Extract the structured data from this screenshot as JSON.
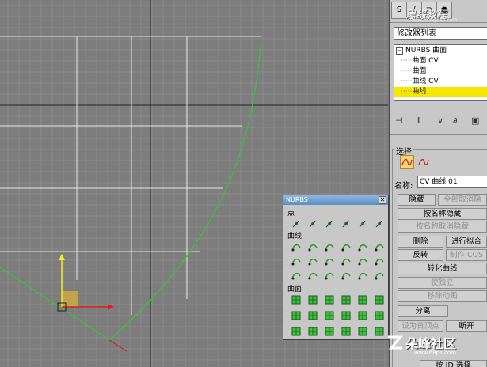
{
  "panel": {
    "tabs": [
      "S",
      "∕",
      "⊃",
      "●"
    ],
    "top_watermark": "思缘教程",
    "top_watermark_sub": "www.missyuan.com",
    "modifier_list_label": "修改器列表",
    "stack": {
      "root": "NURBS 曲面",
      "items": [
        "曲面 CV",
        "曲面",
        "曲线 CV",
        "曲线"
      ],
      "selected_index": 3
    },
    "selection": {
      "title": "选择",
      "name_label": "名称:",
      "name_value": "CV 曲线 01"
    },
    "buttons": {
      "hide": "隐藏",
      "unhide_all": "全部取消隐",
      "hide_by_name": "按名称隐藏",
      "unhide_by_name": "按名称取消隐藏",
      "delete": "删除",
      "attach": "进行拟合",
      "reverse": "反转",
      "make_cos": "制作 COS",
      "convert_curve": "转化曲线",
      "make_independent": "使独立",
      "remove_animation": "移除动画",
      "detach": "分离",
      "copy": "复制",
      "set_first_vertex": "设为首顶点",
      "break": "断开",
      "bottom_partial": "按 ID 选择"
    }
  },
  "nurbs_toolbox": {
    "title": "NURBS",
    "close": "✕",
    "sections": {
      "points": "点",
      "curves": "曲线",
      "surfaces": "曲面"
    }
  },
  "watermark": {
    "text": "朵峰社区",
    "sub": "www.68ps.com"
  },
  "colors": {
    "viewport_bg": "#7d7d7d",
    "grid_minor": "#8c8c8c",
    "grid_major": "#e6e6e6",
    "curve": "#34c834",
    "selection_yellow": "#f5e700"
  }
}
